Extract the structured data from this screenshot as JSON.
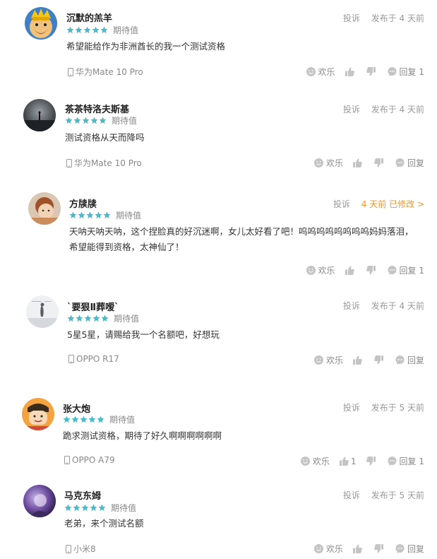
{
  "labels": {
    "report": "投诉",
    "rating": "期待值",
    "fun": "欢乐",
    "reply": "回复"
  },
  "colors": {
    "star": "#4cb9c9",
    "edited": "#f0932b",
    "muted": "#999999"
  },
  "comments": [
    {
      "username": "沉默的羔羊",
      "stars": 5,
      "time": "发布于 4 天前",
      "text": [
        "希望能给作为非洲酋长的我一个测试资格"
      ],
      "device": "华为Mate 10 Pro",
      "likes": "",
      "reply": "回复 1",
      "avatar": "clash-king"
    },
    {
      "username": "茶茶特洛夫斯基",
      "stars": 5,
      "time": "发布于 4 天前",
      "text": [
        "测试资格从天而降吗"
      ],
      "device": "华为Mate 10 Pro",
      "likes": "",
      "reply": "回复",
      "avatar": "dark-sea"
    },
    {
      "username": "方牍牍",
      "stars": 5,
      "time": "4 天前 已修改 >",
      "text": [
        "天呐天呐天呐，这个捏脸真的好沉迷啊，女儿太好看了吧！呜呜呜呜呜呜呜呜妈妈落泪，",
        "希望能得到资格，太神仙了！"
      ],
      "device": "",
      "likes": "",
      "reply": "回复 1",
      "avatar": "child-photo"
    },
    {
      "username": "`要狠Ⅱ葬嗳`",
      "stars": 5,
      "time": "发布于 4 天前",
      "text": [
        "5星5星，请赐给我一个名额吧，好想玩"
      ],
      "device": "OPPO R17",
      "likes": "",
      "reply": "回复",
      "avatar": "grey-figure"
    },
    {
      "username": "张大炮",
      "stars": 5,
      "time": "发布于 5 天前",
      "text": [
        "跪求测试资格，期待了好久啊啊啊啊啊啊"
      ],
      "device": "OPPO A79",
      "likes": "1",
      "reply": "回复 1",
      "avatar": "cartoon-boy"
    },
    {
      "username": "马克东姆",
      "stars": 5,
      "time": "发布于 5 天前",
      "text": [
        "老弟，来个测试名额"
      ],
      "device": "小米8",
      "likes": "",
      "reply": "回复",
      "avatar": "purple-photo"
    }
  ]
}
